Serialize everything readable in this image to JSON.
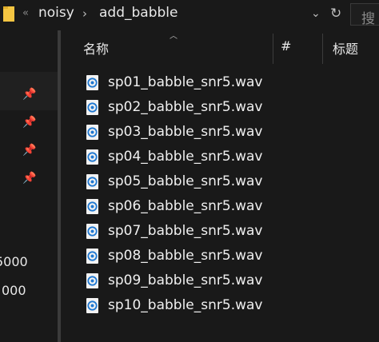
{
  "address": {
    "crumbs": [
      "noisy",
      "add_babble"
    ],
    "back_glyph": "«",
    "search_glyph": "搜"
  },
  "nav": {
    "partial_values": [
      "5000",
      "000"
    ]
  },
  "columns": {
    "name": "名称",
    "number": "#",
    "title": "标题"
  },
  "files": [
    "sp01_babble_snr5.wav",
    "sp02_babble_snr5.wav",
    "sp03_babble_snr5.wav",
    "sp04_babble_snr5.wav",
    "sp05_babble_snr5.wav",
    "sp06_babble_snr5.wav",
    "sp07_babble_snr5.wav",
    "sp08_babble_snr5.wav",
    "sp09_babble_snr5.wav",
    "sp10_babble_snr5.wav"
  ],
  "icons": {
    "folder": "folder-icon",
    "dropdown": "chevron-down-icon",
    "refresh": "refresh-icon",
    "pin": "pin-icon",
    "audio_file": "audio-file-icon",
    "sort": "sort-ascending-icon"
  },
  "colors": {
    "background": "#191919",
    "text": "#f0f0f0",
    "folder": "#f4c542",
    "audio_accent": "#1f78d1"
  }
}
